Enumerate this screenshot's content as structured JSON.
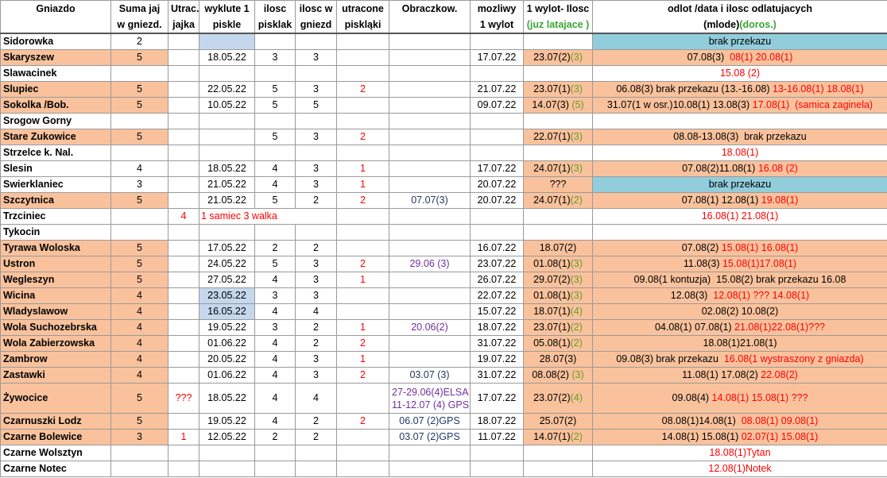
{
  "headers": {
    "row1": [
      "Gniazdo",
      "Suma jaj",
      "Utrac.",
      "wyklute 1",
      "ilosc",
      "ilosc w",
      "utracone",
      "Obraczkow.",
      "mozliwy",
      "1 wylot- Ilosc",
      "odlot /data i ilosc odlatujacych"
    ],
    "row2": [
      "",
      "w gniezd.",
      "jajka",
      "piskle",
      "pisklak",
      "gniezd",
      "piskląki",
      "",
      "1 wylot",
      "(juz latajace )",
      "(mlode)"
    ],
    "row2_extra": "(doros.)"
  },
  "rows": [
    {
      "name": "Sidorowka",
      "eggs": "2",
      "lost_eggs": "",
      "hatched": "",
      "chicks": "",
      "in_nest": "",
      "lost_chicks": "",
      "ringed": "",
      "possible": "",
      "first_flight": [],
      "departure": [
        {
          "t": "brak przekazu",
          "c": "black"
        }
      ]
    },
    {
      "name": "Skaryszew",
      "eggs": "5",
      "lost_eggs": "",
      "hatched": "18.05.22",
      "chicks": "3",
      "in_nest": "3",
      "lost_chicks": "",
      "ringed": "",
      "possible": "17.07.22",
      "first_flight": [
        {
          "t": "23.07(2)",
          "c": "black"
        },
        {
          "t": "(3)",
          "c": "green"
        }
      ],
      "departure": [
        {
          "t": "07.08(3)  ",
          "c": "black"
        },
        {
          "t": "08(1) 20.08(1)",
          "c": "red"
        }
      ]
    },
    {
      "name": "Slawacinek",
      "eggs": "",
      "lost_eggs": "",
      "hatched": "",
      "chicks": "",
      "in_nest": "",
      "lost_chicks": "",
      "ringed": "",
      "possible": "",
      "first_flight": [],
      "departure": [
        {
          "t": "15.08 (2)",
          "c": "red"
        }
      ]
    },
    {
      "name": "Slupiec",
      "eggs": "5",
      "lost_eggs": "",
      "hatched": "22.05.22",
      "chicks": "5",
      "in_nest": "3",
      "lost_chicks": "2",
      "ringed": "",
      "possible": "21.07.22",
      "first_flight": [
        {
          "t": "23.07(1)",
          "c": "black"
        },
        {
          "t": "(3)",
          "c": "green"
        }
      ],
      "departure": [
        {
          "t": "06.08(3) brak przekazu (13.-16.08) ",
          "c": "black"
        },
        {
          "t": "13-16.08(1) 18.08(1)",
          "c": "red"
        }
      ]
    },
    {
      "name": "Sokolka /Bob.",
      "eggs": "5",
      "lost_eggs": "",
      "hatched": "10.05.22",
      "chicks": "5",
      "in_nest": "5",
      "lost_chicks": "",
      "ringed": "",
      "possible": "09.07.22",
      "first_flight": [
        {
          "t": "14.07(3) ",
          "c": "black"
        },
        {
          "t": "(5)",
          "c": "green"
        }
      ],
      "departure": [
        {
          "t": "31.07(1 w osr.)10.08(1) 13.08(3) ",
          "c": "black"
        },
        {
          "t": "17.08(1)  (samica zaginela)",
          "c": "red"
        }
      ]
    },
    {
      "name": "Srogow Gorny",
      "eggs": "",
      "lost_eggs": "",
      "hatched": "",
      "chicks": "",
      "in_nest": "",
      "lost_chicks": "",
      "ringed": "",
      "possible": "",
      "first_flight": [],
      "departure": []
    },
    {
      "name": "Stare Zukowice",
      "eggs": "5",
      "lost_eggs": "",
      "hatched": "",
      "chicks": "5",
      "in_nest": "3",
      "lost_chicks": "2",
      "ringed": "",
      "possible": "",
      "first_flight": [
        {
          "t": "22.07(1)",
          "c": "black"
        },
        {
          "t": "(3)",
          "c": "green"
        }
      ],
      "departure": [
        {
          "t": "08.08-13.08(3)  brak przekazu",
          "c": "black"
        }
      ]
    },
    {
      "name": "Strzelce k. Nal.",
      "eggs": "",
      "lost_eggs": "",
      "hatched": "",
      "chicks": "",
      "in_nest": "",
      "lost_chicks": "",
      "ringed": "",
      "possible": "",
      "first_flight": [],
      "departure": [
        {
          "t": "18.08(1)",
          "c": "red"
        }
      ]
    },
    {
      "name": "Slesin",
      "eggs": "4",
      "lost_eggs": "",
      "hatched": "18.05.22",
      "chicks": "4",
      "in_nest": "3",
      "lost_chicks": "1",
      "ringed": "",
      "possible": "17.07.22",
      "first_flight": [
        {
          "t": "24.07(1)",
          "c": "black"
        },
        {
          "t": "(3)",
          "c": "green"
        }
      ],
      "departure": [
        {
          "t": "07.08(2)11.08(1) ",
          "c": "black"
        },
        {
          "t": "16.08 (2)",
          "c": "red"
        }
      ]
    },
    {
      "name": "Swierklaniec",
      "eggs": "3",
      "lost_eggs": "",
      "hatched": "21.05.22",
      "chicks": "4",
      "in_nest": "3",
      "lost_chicks": "1",
      "ringed": "",
      "possible": "20.07.22",
      "first_flight": [
        {
          "t": "???",
          "c": "black"
        }
      ],
      "departure": [
        {
          "t": "brak przekazu",
          "c": "black"
        }
      ]
    },
    {
      "name": "Szczytnica",
      "eggs": "5",
      "lost_eggs": "",
      "hatched": "21.05.22",
      "chicks": "5",
      "in_nest": "2",
      "lost_chicks": "2",
      "ringed": "07.07(3)",
      "possible": "20.07.22",
      "first_flight": [
        {
          "t": "24.07(1)",
          "c": "black"
        },
        {
          "t": "(2)",
          "c": "green"
        }
      ],
      "departure": [
        {
          "t": "07.08(1) 12.08(1) ",
          "c": "black"
        },
        {
          "t": "19.08(1)",
          "c": "red"
        }
      ]
    },
    {
      "name": "Trzciniec",
      "eggs": "",
      "lost_eggs": "4",
      "hatched": "1 samiec 3 walka",
      "chicks": "",
      "in_nest": "",
      "lost_chicks": "",
      "ringed": "",
      "possible": "",
      "first_flight": [],
      "departure": [
        {
          "t": "16.08(1) 21.08(1)",
          "c": "red"
        }
      ]
    },
    {
      "name": "Tykocin",
      "eggs": "",
      "lost_eggs": "",
      "hatched": "",
      "chicks": "",
      "in_nest": "",
      "lost_chicks": "",
      "ringed": "",
      "possible": "",
      "first_flight": [],
      "departure": []
    },
    {
      "name": "Tyrawa Woloska",
      "eggs": "5",
      "lost_eggs": "",
      "hatched": "17.05.22",
      "chicks": "2",
      "in_nest": "2",
      "lost_chicks": "",
      "ringed": "",
      "possible": "16.07.22",
      "first_flight": [
        {
          "t": "18.07(2)",
          "c": "black"
        }
      ],
      "departure": [
        {
          "t": "07.08(2) ",
          "c": "black"
        },
        {
          "t": "15.08(1) 16.08(1)",
          "c": "red"
        }
      ]
    },
    {
      "name": "Ustron",
      "eggs": "5",
      "lost_eggs": "",
      "hatched": "24.05.22",
      "chicks": "5",
      "in_nest": "3",
      "lost_chicks": "2",
      "ringed": "29.06 (3)",
      "possible": "23.07.22",
      "first_flight": [
        {
          "t": "01.08(1)",
          "c": "black"
        },
        {
          "t": "(3)",
          "c": "green"
        }
      ],
      "departure": [
        {
          "t": "11.08(3) ",
          "c": "black"
        },
        {
          "t": "15.08(1)17.08(1)",
          "c": "red"
        }
      ]
    },
    {
      "name": "Wegleszyn",
      "eggs": "5",
      "lost_eggs": "",
      "hatched": "27.05.22",
      "chicks": "4",
      "in_nest": "3",
      "lost_chicks": "1",
      "ringed": "",
      "possible": "26.07.22",
      "first_flight": [
        {
          "t": "29.07(2)",
          "c": "black"
        },
        {
          "t": "(3)",
          "c": "green"
        }
      ],
      "departure": [
        {
          "t": "09.08(1 kontuzja)  15.08(2) brak przekazu 16.08",
          "c": "black"
        }
      ]
    },
    {
      "name": "Wicina",
      "eggs": "4",
      "lost_eggs": "",
      "hatched": "23.05.22",
      "chicks": "3",
      "in_nest": "3",
      "lost_chicks": "",
      "ringed": "",
      "possible": "22.07.22",
      "first_flight": [
        {
          "t": "01.08(1)",
          "c": "black"
        },
        {
          "t": "(3)",
          "c": "green"
        }
      ],
      "departure": [
        {
          "t": "12.08(3)  ",
          "c": "black"
        },
        {
          "t": "12.08(1) ??? 14.08(1)",
          "c": "red"
        }
      ]
    },
    {
      "name": "Wladyslawow",
      "eggs": "4",
      "lost_eggs": "",
      "hatched": "16.05.22",
      "chicks": "4",
      "in_nest": "4",
      "lost_chicks": "",
      "ringed": "",
      "possible": "15.07.22",
      "first_flight": [
        {
          "t": "18.07(1)",
          "c": "black"
        },
        {
          "t": "(4)",
          "c": "green"
        }
      ],
      "departure": [
        {
          "t": "02.08(2) 10.08(2)",
          "c": "black"
        }
      ]
    },
    {
      "name": "Wola Suchozebrska",
      "eggs": "4",
      "lost_eggs": "",
      "hatched": "19.05.22",
      "chicks": "3",
      "in_nest": "2",
      "lost_chicks": "1",
      "ringed": "20.06(2)",
      "possible": "18.07.22",
      "first_flight": [
        {
          "t": "23.07(1)",
          "c": "black"
        },
        {
          "t": "(2)",
          "c": "green"
        }
      ],
      "departure": [
        {
          "t": "04.08(1) 07.08(1) ",
          "c": "black"
        },
        {
          "t": "21.08(1)22.08(1)???",
          "c": "red"
        }
      ]
    },
    {
      "name": "Wola Zabierzowska",
      "eggs": "4",
      "lost_eggs": "",
      "hatched": "01.06.22",
      "chicks": "4",
      "in_nest": "2",
      "lost_chicks": "2",
      "ringed": "",
      "possible": "31.07.22",
      "first_flight": [
        {
          "t": "05.08(1)",
          "c": "black"
        },
        {
          "t": "(2)",
          "c": "green"
        }
      ],
      "departure": [
        {
          "t": "18.08(1)21.08(1)",
          "c": "black"
        }
      ]
    },
    {
      "name": "Zambrow",
      "eggs": "4",
      "lost_eggs": "",
      "hatched": "20.05.22",
      "chicks": "4",
      "in_nest": "3",
      "lost_chicks": "1",
      "ringed": "",
      "possible": "19.07.22",
      "first_flight": [
        {
          "t": "28.07(3)",
          "c": "black"
        }
      ],
      "departure": [
        {
          "t": "09.08(3) brak przekazu  ",
          "c": "black"
        },
        {
          "t": "16.08(1 wystraszony z gniazda)",
          "c": "red"
        }
      ]
    },
    {
      "name": "Zastawki",
      "eggs": "4",
      "lost_eggs": "",
      "hatched": "01.06.22",
      "chicks": "4",
      "in_nest": "3",
      "lost_chicks": "2",
      "ringed": "03.07 (3)",
      "possible": "31.07.22",
      "first_flight": [
        {
          "t": "08.08(2) ",
          "c": "black"
        },
        {
          "t": "(3)",
          "c": "green"
        }
      ],
      "departure": [
        {
          "t": "11.08(1) 17.08(2) ",
          "c": "black"
        },
        {
          "t": "22.08(2)",
          "c": "red"
        }
      ]
    },
    {
      "name": "Żywocice",
      "eggs": "5",
      "lost_eggs": "???",
      "hatched": "18.05.22",
      "chicks": "4",
      "in_nest": "4",
      "lost_chicks": "",
      "ringed": "27-29.06(4)ELSA",
      "ringed2": "11-12.07 (4) GPS",
      "possible": "17.07.22",
      "first_flight": [
        {
          "t": "23.07(2)",
          "c": "black"
        },
        {
          "t": "(4)",
          "c": "green"
        }
      ],
      "departure": [
        {
          "t": "09.08(4) ",
          "c": "black"
        },
        {
          "t": "14.08(1) 15.08(1) ???",
          "c": "red"
        }
      ]
    },
    {
      "name": "Czarnuszki Lodz",
      "eggs": "5",
      "lost_eggs": "",
      "hatched": "19.05.22",
      "chicks": "4",
      "in_nest": "2",
      "lost_chicks": "2",
      "ringed": "06.07 (2)GPS",
      "possible": "18.07.22",
      "first_flight": [
        {
          "t": "25.07(2)",
          "c": "black"
        }
      ],
      "departure": [
        {
          "t": "08.08(1)14.08(1)  ",
          "c": "black"
        },
        {
          "t": "08.08(1) 09.08(1)",
          "c": "red"
        }
      ]
    },
    {
      "name": "Czarne Bolewice",
      "eggs": "3",
      "lost_eggs": "1",
      "hatched": "12.05.22",
      "chicks": "2",
      "in_nest": "2",
      "lost_chicks": "",
      "ringed": "03.07 (2)GPS",
      "possible": "11.07.22",
      "first_flight": [
        {
          "t": "14.07(1)",
          "c": "black"
        },
        {
          "t": "(2)",
          "c": "green"
        }
      ],
      "departure": [
        {
          "t": "14.08(1) 15.08(1) ",
          "c": "black"
        },
        {
          "t": "02.07(1) 15.08(1)",
          "c": "red"
        }
      ]
    },
    {
      "name": "Czarne Wolsztyn",
      "eggs": "",
      "lost_eggs": "",
      "hatched": "",
      "chicks": "",
      "in_nest": "",
      "lost_chicks": "",
      "ringed": "",
      "possible": "",
      "first_flight": [],
      "departure": [
        {
          "t": "18.08(1)Tytan",
          "c": "red"
        }
      ]
    },
    {
      "name": "Czarne Notec",
      "eggs": "",
      "lost_eggs": "",
      "hatched": "",
      "chicks": "",
      "in_nest": "",
      "lost_chicks": "",
      "ringed": "",
      "possible": "",
      "first_flight": [],
      "departure": [
        {
          "t": "12.08(1)Notek",
          "c": "red"
        }
      ]
    }
  ],
  "colors": {
    "orange_fill": "#f9c29c",
    "blue_fill": "#c4d7ed",
    "teal_fill": "#92cddc",
    "red_text": "#ff0000",
    "purple_text": "#7030a0",
    "navy_text": "#1f3864",
    "green_text": "#6b9a2b"
  }
}
